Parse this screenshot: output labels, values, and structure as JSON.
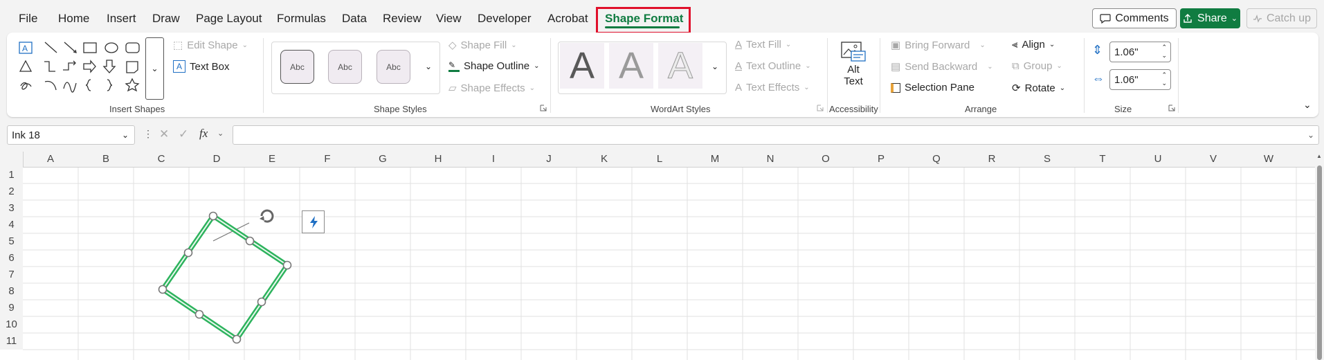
{
  "tabs": [
    "File",
    "Home",
    "Insert",
    "Draw",
    "Page Layout",
    "Formulas",
    "Data",
    "Review",
    "View",
    "Developer",
    "Acrobat",
    "Shape Format"
  ],
  "active_tab": "Shape Format",
  "top_buttons": {
    "comments": "Comments",
    "share": "Share",
    "catch_up": "Catch up"
  },
  "ribbon": {
    "insert_shapes": {
      "label": "Insert Shapes",
      "edit_shape": "Edit Shape",
      "text_box": "Text Box"
    },
    "shape_styles": {
      "label": "Shape Styles",
      "style_samples": [
        "Abc",
        "Abc",
        "Abc"
      ],
      "shape_fill": "Shape Fill",
      "shape_outline": "Shape Outline",
      "shape_effects": "Shape Effects"
    },
    "wordart_styles": {
      "label": "WordArt Styles",
      "samples": [
        "A",
        "A",
        "A"
      ],
      "text_fill": "Text Fill",
      "text_outline": "Text Outline",
      "text_effects": "Text Effects"
    },
    "accessibility": {
      "label": "Accessibility",
      "alt_text_line1": "Alt",
      "alt_text_line2": "Text"
    },
    "arrange": {
      "label": "Arrange",
      "bring_forward": "Bring Forward",
      "send_backward": "Send Backward",
      "selection_pane": "Selection Pane",
      "align": "Align",
      "group": "Group",
      "rotate": "Rotate"
    },
    "size": {
      "label": "Size",
      "height": "1.06\"",
      "width": "1.06\""
    }
  },
  "formula_bar": {
    "name_box": "Ink 18",
    "fx": "fx",
    "formula": ""
  },
  "columns": [
    "A",
    "B",
    "C",
    "D",
    "E",
    "F",
    "G",
    "H",
    "I",
    "J",
    "K",
    "L",
    "M",
    "N",
    "O",
    "P",
    "Q",
    "R",
    "S",
    "T",
    "U",
    "V",
    "W"
  ],
  "rows": [
    "1",
    "2",
    "3",
    "4",
    "5",
    "6",
    "7",
    "8",
    "9",
    "10",
    "11"
  ],
  "colors": {
    "accent": "#107c41",
    "highlight": "#e0102b",
    "ink_stroke": "#2db35d"
  }
}
